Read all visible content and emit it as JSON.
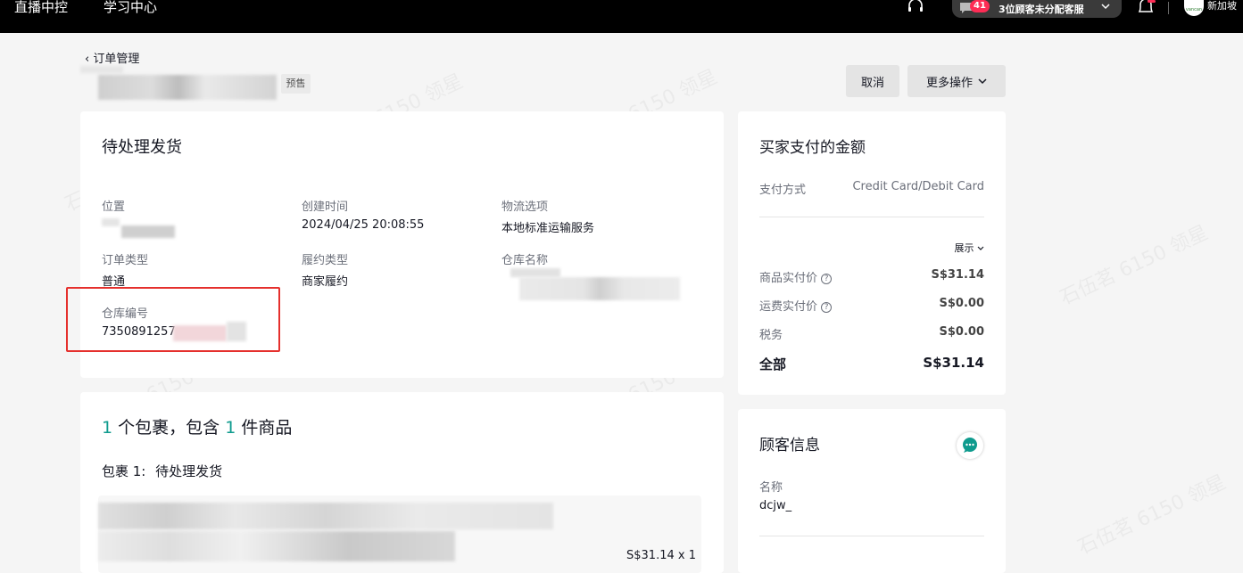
{
  "topbar": {
    "nav1": "直播中控",
    "nav2": "学习中心",
    "badge_count": "41",
    "customer_service": "3位顾客未分配客服",
    "region": "新加坡",
    "avatar_text": "vancan"
  },
  "header": {
    "back": "订单管理",
    "presale_tag": "预售",
    "cancel_label": "取消",
    "more_label": "更多操作"
  },
  "status_card": {
    "title": "待处理发货",
    "fields": [
      {
        "label": "位置",
        "value": ""
      },
      {
        "label": "创建时间",
        "value": "2024/04/25 20:08:55"
      },
      {
        "label": "物流选项",
        "value": "本地标准运输服务"
      },
      {
        "label": "订单类型",
        "value": "普通"
      },
      {
        "label": "履约类型",
        "value": "商家履约"
      },
      {
        "label": "仓库名称",
        "value": ""
      },
      {
        "label": "仓库编号",
        "value": "7350891257"
      }
    ]
  },
  "package_card": {
    "count": "1",
    "mid_text": "个包裹，包含",
    "items": "1",
    "tail_text": "件商品",
    "package_label": "包裹 1:",
    "package_status": "待处理发货",
    "price_qty": "S$31.14 x 1"
  },
  "payment_card": {
    "title": "买家支付的金额",
    "method_label": "支付方式",
    "method_value": "Credit Card/Debit Card",
    "expand": "展示",
    "rows": [
      {
        "label": "商品实付价",
        "value": "S$31.14"
      },
      {
        "label": "运费实付价",
        "value": "S$0.00"
      },
      {
        "label": "税务",
        "value": "S$0.00"
      }
    ],
    "total_label": "全部",
    "total_value": "S$31.14"
  },
  "customer_card": {
    "title": "顾客信息",
    "name_label": "名称",
    "name_value": "dcjw_"
  },
  "watermark": "石伍茗 6150 领星"
}
